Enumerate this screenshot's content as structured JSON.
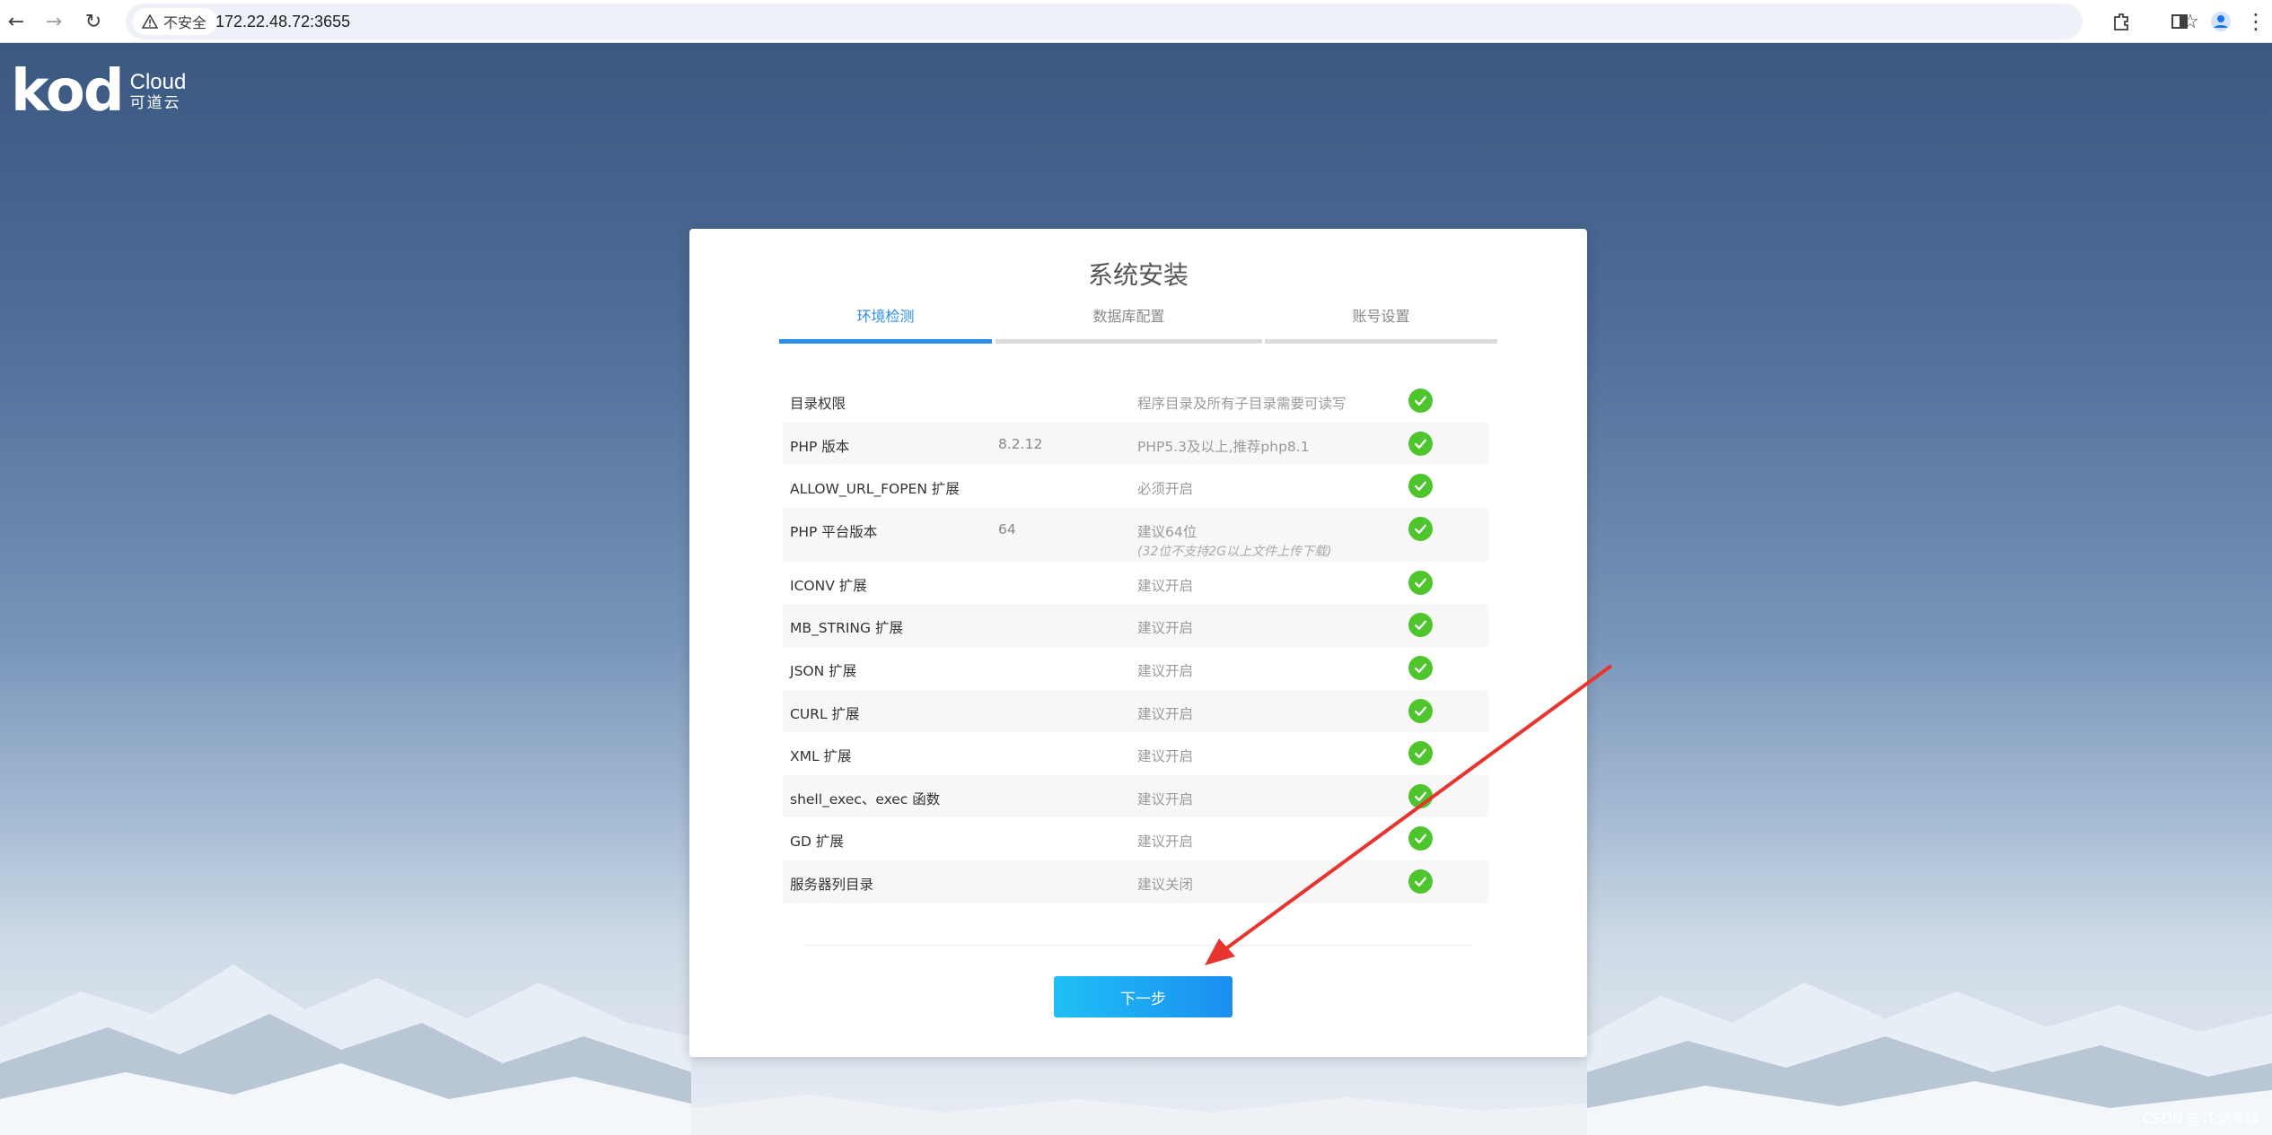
{
  "browser": {
    "security_label": "不安全",
    "url": "172.22.48.72:3655"
  },
  "logo": {
    "brand": "kod",
    "cloud": "Cloud",
    "cn": "可道云"
  },
  "install": {
    "title": "系统安装",
    "steps": [
      {
        "label": "环境检测",
        "active": true
      },
      {
        "label": "数据库配置",
        "active": false
      },
      {
        "label": "账号设置",
        "active": false
      }
    ],
    "rows": [
      {
        "name": "目录权限",
        "value": "",
        "requirement": "程序目录及所有子目录需要可读写",
        "note": "",
        "status": "ok"
      },
      {
        "name": "PHP 版本",
        "value": "8.2.12",
        "requirement": "PHP5.3及以上,推荐php8.1",
        "note": "",
        "status": "ok"
      },
      {
        "name": "ALLOW_URL_FOPEN 扩展",
        "value": "",
        "requirement": "必须开启",
        "note": "",
        "status": "ok"
      },
      {
        "name": "PHP 平台版本",
        "value": "64",
        "requirement": "建议64位",
        "note": "(32位不支持2G以上文件上传下载)",
        "status": "ok"
      },
      {
        "name": "ICONV 扩展",
        "value": "",
        "requirement": "建议开启",
        "note": "",
        "status": "ok"
      },
      {
        "name": "MB_STRING 扩展",
        "value": "",
        "requirement": "建议开启",
        "note": "",
        "status": "ok"
      },
      {
        "name": "JSON 扩展",
        "value": "",
        "requirement": "建议开启",
        "note": "",
        "status": "ok"
      },
      {
        "name": "CURL 扩展",
        "value": "",
        "requirement": "建议开启",
        "note": "",
        "status": "ok"
      },
      {
        "name": "XML 扩展",
        "value": "",
        "requirement": "建议开启",
        "note": "",
        "status": "ok"
      },
      {
        "name": "shell_exec、exec 函数",
        "value": "",
        "requirement": "建议开启",
        "note": "",
        "status": "ok"
      },
      {
        "name": "GD 扩展",
        "value": "",
        "requirement": "建议开启",
        "note": "",
        "status": "ok"
      },
      {
        "name": "服务器列目录",
        "value": "",
        "requirement": "建议关闭",
        "note": "",
        "status": "ok"
      }
    ],
    "next_label": "下一步"
  },
  "watermark": "CSDN @江湖有缘",
  "colors": {
    "accent": "#2b8de4",
    "ok": "#4ec52c",
    "annotation_arrow": "#e8342e"
  }
}
